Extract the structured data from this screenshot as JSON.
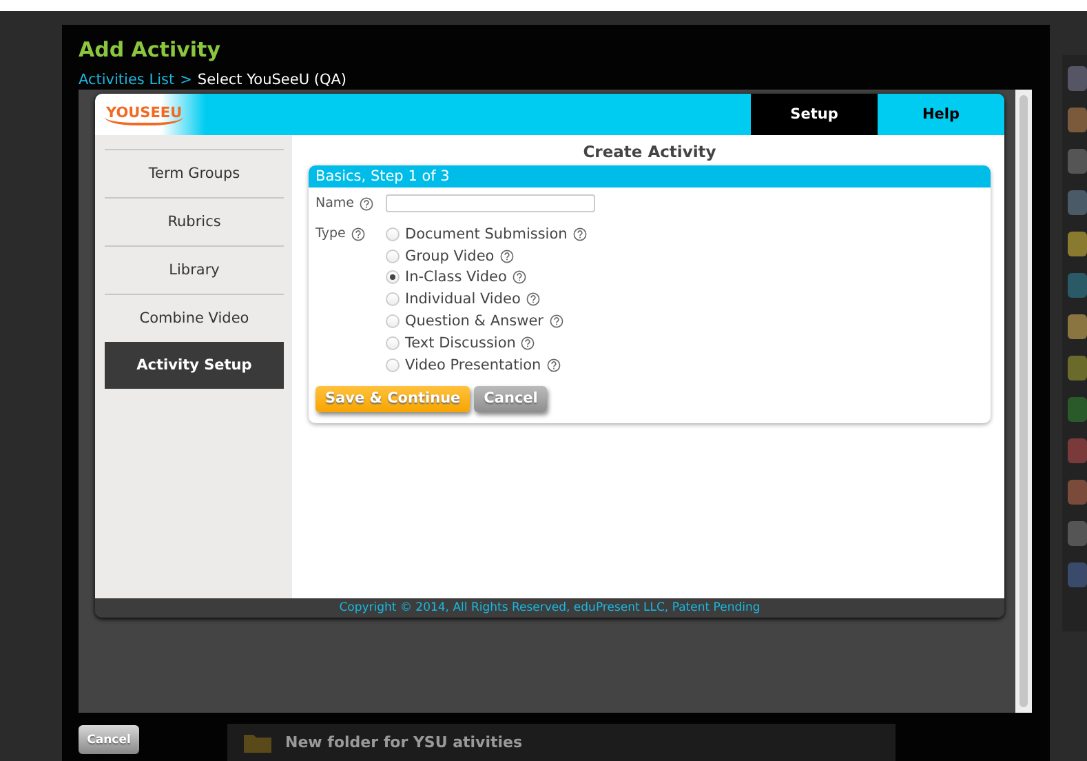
{
  "background": {
    "folder_label": "New folder for YSU ativities"
  },
  "modal": {
    "title": "Add Activity",
    "breadcrumb": [
      {
        "label": "Activities List",
        "kind": "link"
      },
      {
        "label": ">",
        "kind": "separator"
      },
      {
        "label": "Select YouSeeU (QA)",
        "kind": "current"
      }
    ],
    "app": {
      "logo": "YOUSEEU",
      "tabs": [
        {
          "label": "Setup",
          "selected": true
        },
        {
          "label": "Help",
          "selected": false
        }
      ],
      "sidebar": [
        {
          "label": "Term Groups",
          "selected": false
        },
        {
          "label": "Rubrics",
          "selected": false
        },
        {
          "label": "Library",
          "selected": false
        },
        {
          "label": "Combine Video",
          "selected": false
        },
        {
          "label": "Activity Setup",
          "selected": true
        }
      ],
      "heading": "Create Activity",
      "panel": {
        "title": "Basics, Step 1 of 3",
        "name_label": "Name",
        "type_label": "Type",
        "types": [
          {
            "label": "Document Submission",
            "selected": false
          },
          {
            "label": "Group Video",
            "selected": false
          },
          {
            "label": "In-Class Video",
            "selected": true
          },
          {
            "label": "Individual Video",
            "selected": false
          },
          {
            "label": "Question & Answer",
            "selected": false
          },
          {
            "label": "Text Discussion",
            "selected": false
          },
          {
            "label": "Video Presentation",
            "selected": false
          }
        ],
        "buttons": [
          {
            "label": "Save & Continue",
            "kind": "primary"
          },
          {
            "label": "Cancel",
            "kind": "secondary"
          }
        ]
      },
      "footer": "Copyright © 2014, All Rights Reserved, eduPresent LLC, Patent Pending"
    },
    "cancel_button": "Cancel"
  }
}
